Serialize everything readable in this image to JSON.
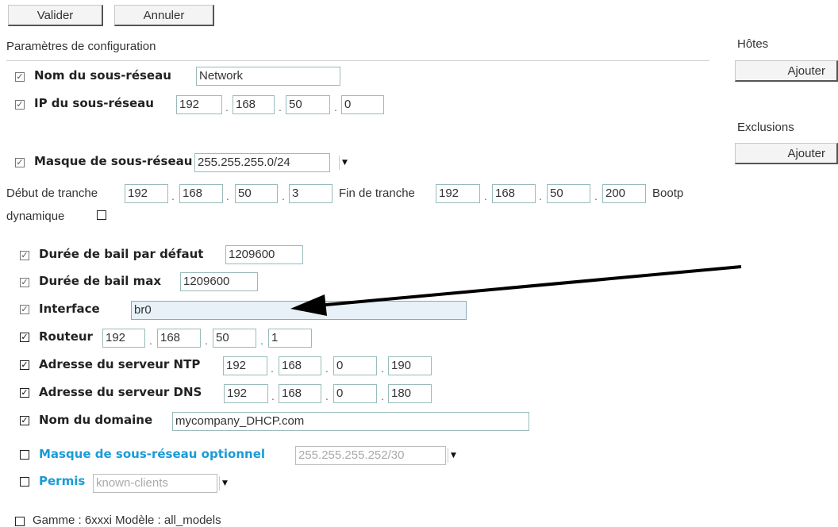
{
  "toolbar": {
    "validate_label": "Valider",
    "cancel_label": "Annuler"
  },
  "section_title": "Paramètres de configuration",
  "hosts": {
    "title": "Hôtes",
    "add_label": "Ajouter"
  },
  "exclusions": {
    "title": "Exclusions",
    "add_label": "Ajouter"
  },
  "subnet_name": {
    "label": "Nom du sous-réseau",
    "value": "Network",
    "checked": true
  },
  "subnet_ip": {
    "label": "IP du sous-réseau",
    "octets": [
      "192",
      "168",
      "50",
      "0"
    ],
    "checked": true
  },
  "subnet_mask": {
    "label": "Masque de sous-réseau",
    "value": "255.255.255.0/24",
    "checked": true
  },
  "range": {
    "start_label": "Début de tranche",
    "start": [
      "192",
      "168",
      "50",
      "3"
    ],
    "end_label": "Fin de tranche",
    "end": [
      "192",
      "168",
      "50",
      "200"
    ],
    "bootp_label": "Bootp",
    "dynamic_label": "dynamique",
    "dynamic_checked": false
  },
  "default_lease": {
    "label": "Durée de bail par défaut",
    "value": "1209600",
    "checked": true
  },
  "max_lease": {
    "label": "Durée de bail max",
    "value": "1209600",
    "checked": true
  },
  "interface": {
    "label": "Interface",
    "value": "br0",
    "checked": true
  },
  "router": {
    "label": "Routeur",
    "octets": [
      "192",
      "168",
      "50",
      "1"
    ],
    "checked": true
  },
  "ntp": {
    "label": "Adresse du serveur NTP",
    "octets": [
      "192",
      "168",
      "0",
      "190"
    ],
    "checked": true
  },
  "dns": {
    "label": "Adresse du serveur DNS",
    "octets": [
      "192",
      "168",
      "0",
      "180"
    ],
    "checked": true
  },
  "domain": {
    "label": "Nom du domaine",
    "value": "mycompany_DHCP.com",
    "checked": true
  },
  "optional_mask": {
    "label": "Masque de sous-réseau optionnel",
    "value": "255.255.255.252/30",
    "checked": false
  },
  "permit": {
    "label": "Permis",
    "value": "known-clients",
    "checked": false
  },
  "range_model": {
    "label": "Gamme : 6xxxi Modèle : all_models",
    "checked": false
  },
  "sep": "."
}
